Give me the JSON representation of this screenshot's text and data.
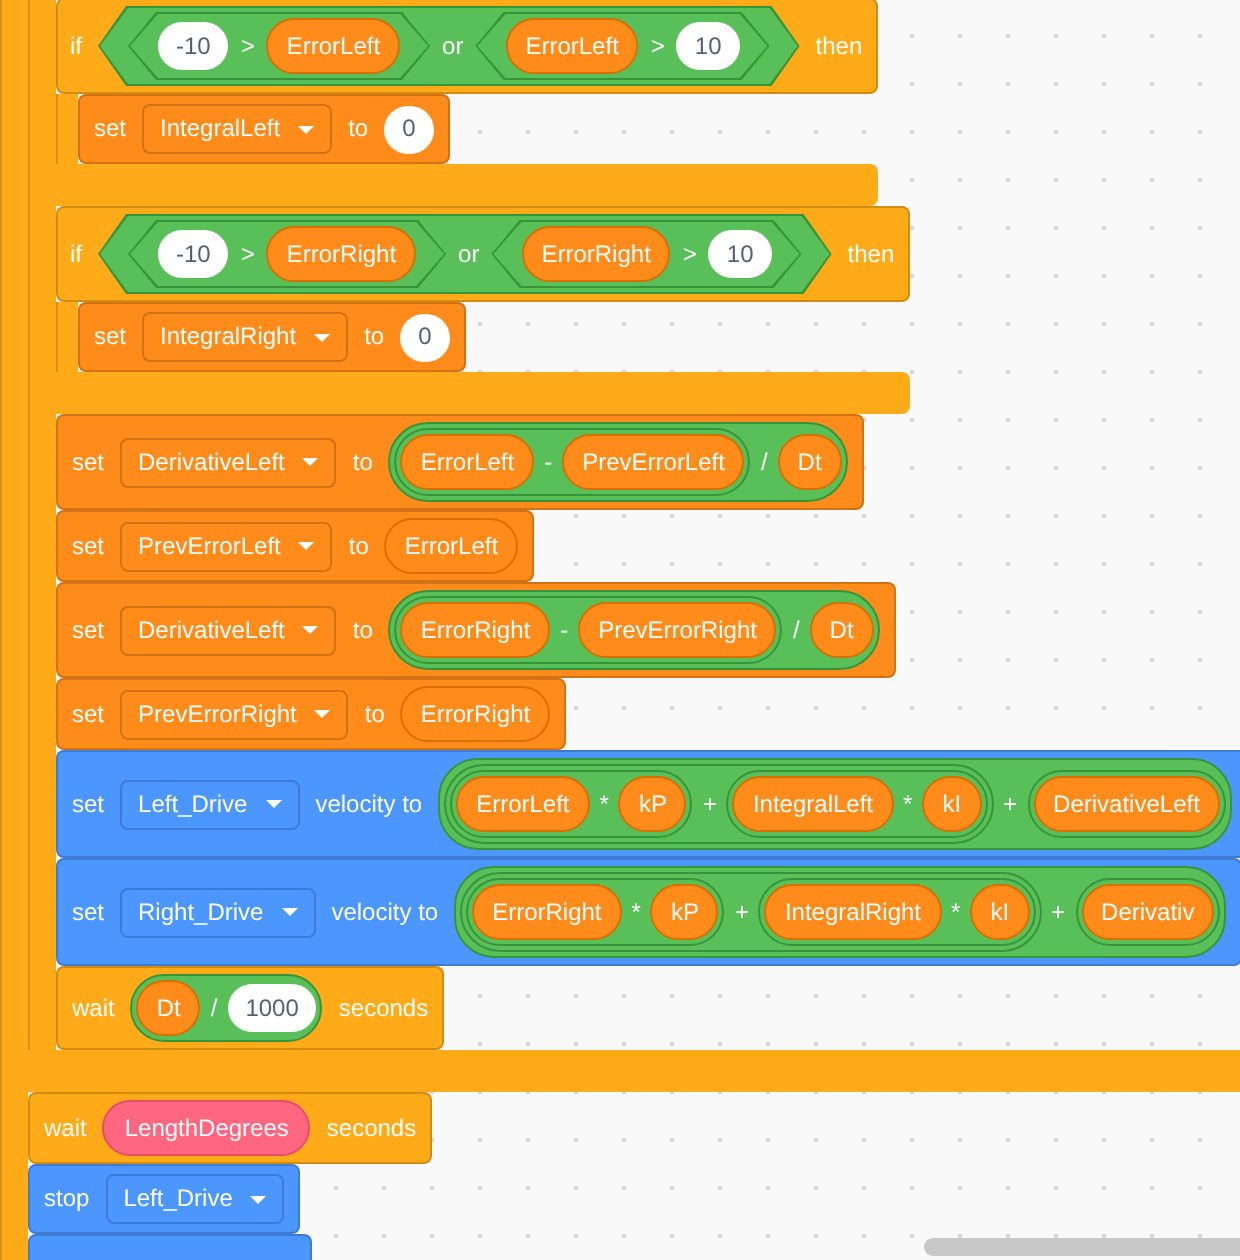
{
  "script": {
    "kind": "loop",
    "color": "#ffab19",
    "body": [
      {
        "kind": "loop",
        "color": "#ffab19",
        "body": [
          {
            "kind": "if",
            "color": "#ffab19",
            "parts": [
              {
                "kind": "label",
                "text": "if"
              },
              {
                "kind": "boolean",
                "parts": [
                  {
                    "kind": "boolean",
                    "parts": [
                      {
                        "kind": "number",
                        "text": "-10"
                      },
                      {
                        "kind": "symbol",
                        "text": ">"
                      },
                      {
                        "kind": "variable",
                        "text": "ErrorLeft"
                      }
                    ]
                  },
                  {
                    "kind": "symbol",
                    "text": "or"
                  },
                  {
                    "kind": "boolean",
                    "parts": [
                      {
                        "kind": "variable",
                        "text": "ErrorLeft"
                      },
                      {
                        "kind": "symbol",
                        "text": ">"
                      },
                      {
                        "kind": "number",
                        "text": "10"
                      }
                    ]
                  }
                ]
              },
              {
                "kind": "label",
                "text": "then"
              }
            ],
            "body": [
              {
                "kind": "stack",
                "color": "#ff8c1a",
                "parts": [
                  {
                    "kind": "label",
                    "text": "set"
                  },
                  {
                    "kind": "dropdown",
                    "text": "IntegralLeft"
                  },
                  {
                    "kind": "label",
                    "text": "to"
                  },
                  {
                    "kind": "number",
                    "text": "0"
                  }
                ]
              }
            ]
          },
          {
            "kind": "if",
            "color": "#ffab19",
            "parts": [
              {
                "kind": "label",
                "text": "if"
              },
              {
                "kind": "boolean",
                "parts": [
                  {
                    "kind": "boolean",
                    "parts": [
                      {
                        "kind": "number",
                        "text": "-10"
                      },
                      {
                        "kind": "symbol",
                        "text": ">"
                      },
                      {
                        "kind": "variable",
                        "text": "ErrorRight"
                      }
                    ]
                  },
                  {
                    "kind": "symbol",
                    "text": "or"
                  },
                  {
                    "kind": "boolean",
                    "parts": [
                      {
                        "kind": "variable",
                        "text": "ErrorRight"
                      },
                      {
                        "kind": "symbol",
                        "text": ">"
                      },
                      {
                        "kind": "number",
                        "text": "10"
                      }
                    ]
                  }
                ]
              },
              {
                "kind": "label",
                "text": "then"
              }
            ],
            "body": [
              {
                "kind": "stack",
                "color": "#ff8c1a",
                "parts": [
                  {
                    "kind": "label",
                    "text": "set"
                  },
                  {
                    "kind": "dropdown",
                    "text": "IntegralRight"
                  },
                  {
                    "kind": "label",
                    "text": "to"
                  },
                  {
                    "kind": "number",
                    "text": "0"
                  }
                ]
              }
            ]
          },
          {
            "kind": "stack",
            "color": "#ff8c1a",
            "parts": [
              {
                "kind": "label",
                "text": "set"
              },
              {
                "kind": "dropdown",
                "text": "DerivativeLeft"
              },
              {
                "kind": "label",
                "text": "to"
              },
              {
                "kind": "operator",
                "parts": [
                  {
                    "kind": "operator",
                    "parts": [
                      {
                        "kind": "variable",
                        "text": "ErrorLeft"
                      },
                      {
                        "kind": "symbol",
                        "text": "-"
                      },
                      {
                        "kind": "variable",
                        "text": "PrevErrorLeft"
                      }
                    ]
                  },
                  {
                    "kind": "symbol",
                    "text": "/"
                  },
                  {
                    "kind": "variable",
                    "text": "Dt"
                  }
                ]
              }
            ]
          },
          {
            "kind": "stack",
            "color": "#ff8c1a",
            "parts": [
              {
                "kind": "label",
                "text": "set"
              },
              {
                "kind": "dropdown",
                "text": "PrevErrorLeft"
              },
              {
                "kind": "label",
                "text": "to"
              },
              {
                "kind": "variable",
                "text": "ErrorLeft"
              }
            ]
          },
          {
            "kind": "stack",
            "color": "#ff8c1a",
            "parts": [
              {
                "kind": "label",
                "text": "set"
              },
              {
                "kind": "dropdown",
                "text": "DerivativeLeft"
              },
              {
                "kind": "label",
                "text": "to"
              },
              {
                "kind": "operator",
                "parts": [
                  {
                    "kind": "operator",
                    "parts": [
                      {
                        "kind": "variable",
                        "text": "ErrorRight"
                      },
                      {
                        "kind": "symbol",
                        "text": "-"
                      },
                      {
                        "kind": "variable",
                        "text": "PrevErrorRight"
                      }
                    ]
                  },
                  {
                    "kind": "symbol",
                    "text": "/"
                  },
                  {
                    "kind": "variable",
                    "text": "Dt"
                  }
                ]
              }
            ]
          },
          {
            "kind": "stack",
            "color": "#ff8c1a",
            "parts": [
              {
                "kind": "label",
                "text": "set"
              },
              {
                "kind": "dropdown",
                "text": "PrevErrorRight"
              },
              {
                "kind": "label",
                "text": "to"
              },
              {
                "kind": "variable",
                "text": "ErrorRight"
              }
            ]
          },
          {
            "kind": "stack",
            "color": "#4c97ff",
            "parts": [
              {
                "kind": "label",
                "text": "set"
              },
              {
                "kind": "dropdown",
                "text": "Left_Drive"
              },
              {
                "kind": "label",
                "text": "velocity to"
              },
              {
                "kind": "operator",
                "parts": [
                  {
                    "kind": "operator",
                    "parts": [
                      {
                        "kind": "operator",
                        "parts": [
                          {
                            "kind": "variable",
                            "text": "ErrorLeft"
                          },
                          {
                            "kind": "symbol",
                            "text": "*"
                          },
                          {
                            "kind": "variable",
                            "text": "kP"
                          }
                        ]
                      },
                      {
                        "kind": "symbol",
                        "text": "+"
                      },
                      {
                        "kind": "operator",
                        "parts": [
                          {
                            "kind": "variable",
                            "text": "IntegralLeft"
                          },
                          {
                            "kind": "symbol",
                            "text": "*"
                          },
                          {
                            "kind": "variable",
                            "text": "kI"
                          }
                        ]
                      }
                    ]
                  },
                  {
                    "kind": "symbol",
                    "text": "+"
                  },
                  {
                    "kind": "operator",
                    "parts": [
                      {
                        "kind": "variable",
                        "text": "DerivativeLeft"
                      }
                    ]
                  }
                ]
              }
            ]
          },
          {
            "kind": "stack",
            "color": "#4c97ff",
            "parts": [
              {
                "kind": "label",
                "text": "set"
              },
              {
                "kind": "dropdown",
                "text": "Right_Drive"
              },
              {
                "kind": "label",
                "text": "velocity to"
              },
              {
                "kind": "operator",
                "parts": [
                  {
                    "kind": "operator",
                    "parts": [
                      {
                        "kind": "operator",
                        "parts": [
                          {
                            "kind": "variable",
                            "text": "ErrorRight"
                          },
                          {
                            "kind": "symbol",
                            "text": "*"
                          },
                          {
                            "kind": "variable",
                            "text": "kP"
                          }
                        ]
                      },
                      {
                        "kind": "symbol",
                        "text": "+"
                      },
                      {
                        "kind": "operator",
                        "parts": [
                          {
                            "kind": "variable",
                            "text": "IntegralRight"
                          },
                          {
                            "kind": "symbol",
                            "text": "*"
                          },
                          {
                            "kind": "variable",
                            "text": "kI"
                          }
                        ]
                      }
                    ]
                  },
                  {
                    "kind": "symbol",
                    "text": "+"
                  },
                  {
                    "kind": "operator",
                    "parts": [
                      {
                        "kind": "variable",
                        "text": "Derivativ"
                      }
                    ]
                  }
                ]
              }
            ]
          },
          {
            "kind": "stack",
            "color": "#ffab19",
            "parts": [
              {
                "kind": "label",
                "text": "wait"
              },
              {
                "kind": "operator",
                "parts": [
                  {
                    "kind": "variable",
                    "text": "Dt"
                  },
                  {
                    "kind": "symbol",
                    "text": "/"
                  },
                  {
                    "kind": "number",
                    "text": "1000"
                  }
                ]
              },
              {
                "kind": "label",
                "text": "seconds"
              }
            ]
          }
        ]
      },
      {
        "kind": "stack",
        "color": "#ffab19",
        "parts": [
          {
            "kind": "label",
            "text": "wait"
          },
          {
            "kind": "parameter",
            "text": "LengthDegrees"
          },
          {
            "kind": "label",
            "text": "seconds"
          }
        ]
      },
      {
        "kind": "stack",
        "color": "#4c97ff",
        "parts": [
          {
            "kind": "label",
            "text": "stop"
          },
          {
            "kind": "dropdown",
            "text": "Left_Drive"
          }
        ]
      },
      {
        "kind": "stack",
        "color": "#4c97ff"
      }
    ]
  },
  "scrollbar": {
    "kind": "horizontal"
  }
}
